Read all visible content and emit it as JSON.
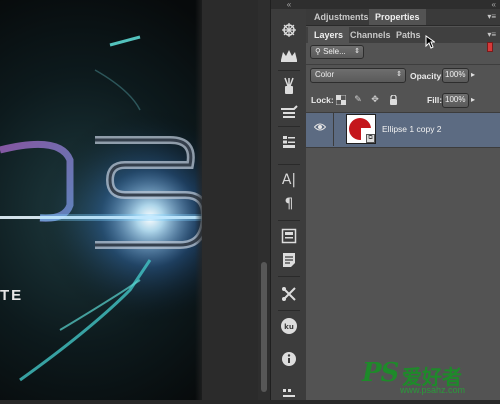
{
  "panel": {
    "tabs_top": [
      {
        "label": "Adjustments",
        "active": false
      },
      {
        "label": "Properties",
        "active": true
      }
    ],
    "tabs_layers": [
      {
        "label": "Layers",
        "active": true
      },
      {
        "label": "Channels",
        "active": false
      },
      {
        "label": "Paths",
        "active": false
      }
    ],
    "collapse_glyph": "«",
    "menu_glyph": "▾≡",
    "filter_kind": "Sele...",
    "blend_mode": "Color",
    "opacity_label": "Opacity:",
    "opacity_value": "100%",
    "lock_label": "Lock:",
    "fill_label": "Fill:",
    "fill_value": "100%",
    "layer": {
      "name": "Ellipse 1 copy 2",
      "visible": true,
      "selected": true
    }
  },
  "dock": {
    "collapse_glyph": "«",
    "tools": [
      "ship-wheel-icon",
      "crown-icon",
      "brushes-icon",
      "brush-settings-icon",
      "properties-icon",
      "character-icon",
      "paragraph-icon",
      "history-icon",
      "notes-icon",
      "tool-presets-icon",
      "kuler-icon",
      "info-icon",
      "timeline-icon"
    ]
  },
  "watermark": {
    "logo": "PS",
    "cn": "爱好者",
    "url": "www.psahz.com"
  },
  "colors": {
    "selected_row": "#5c6b82",
    "panel_bg": "#535353",
    "filter_red": "#d63a3a"
  }
}
